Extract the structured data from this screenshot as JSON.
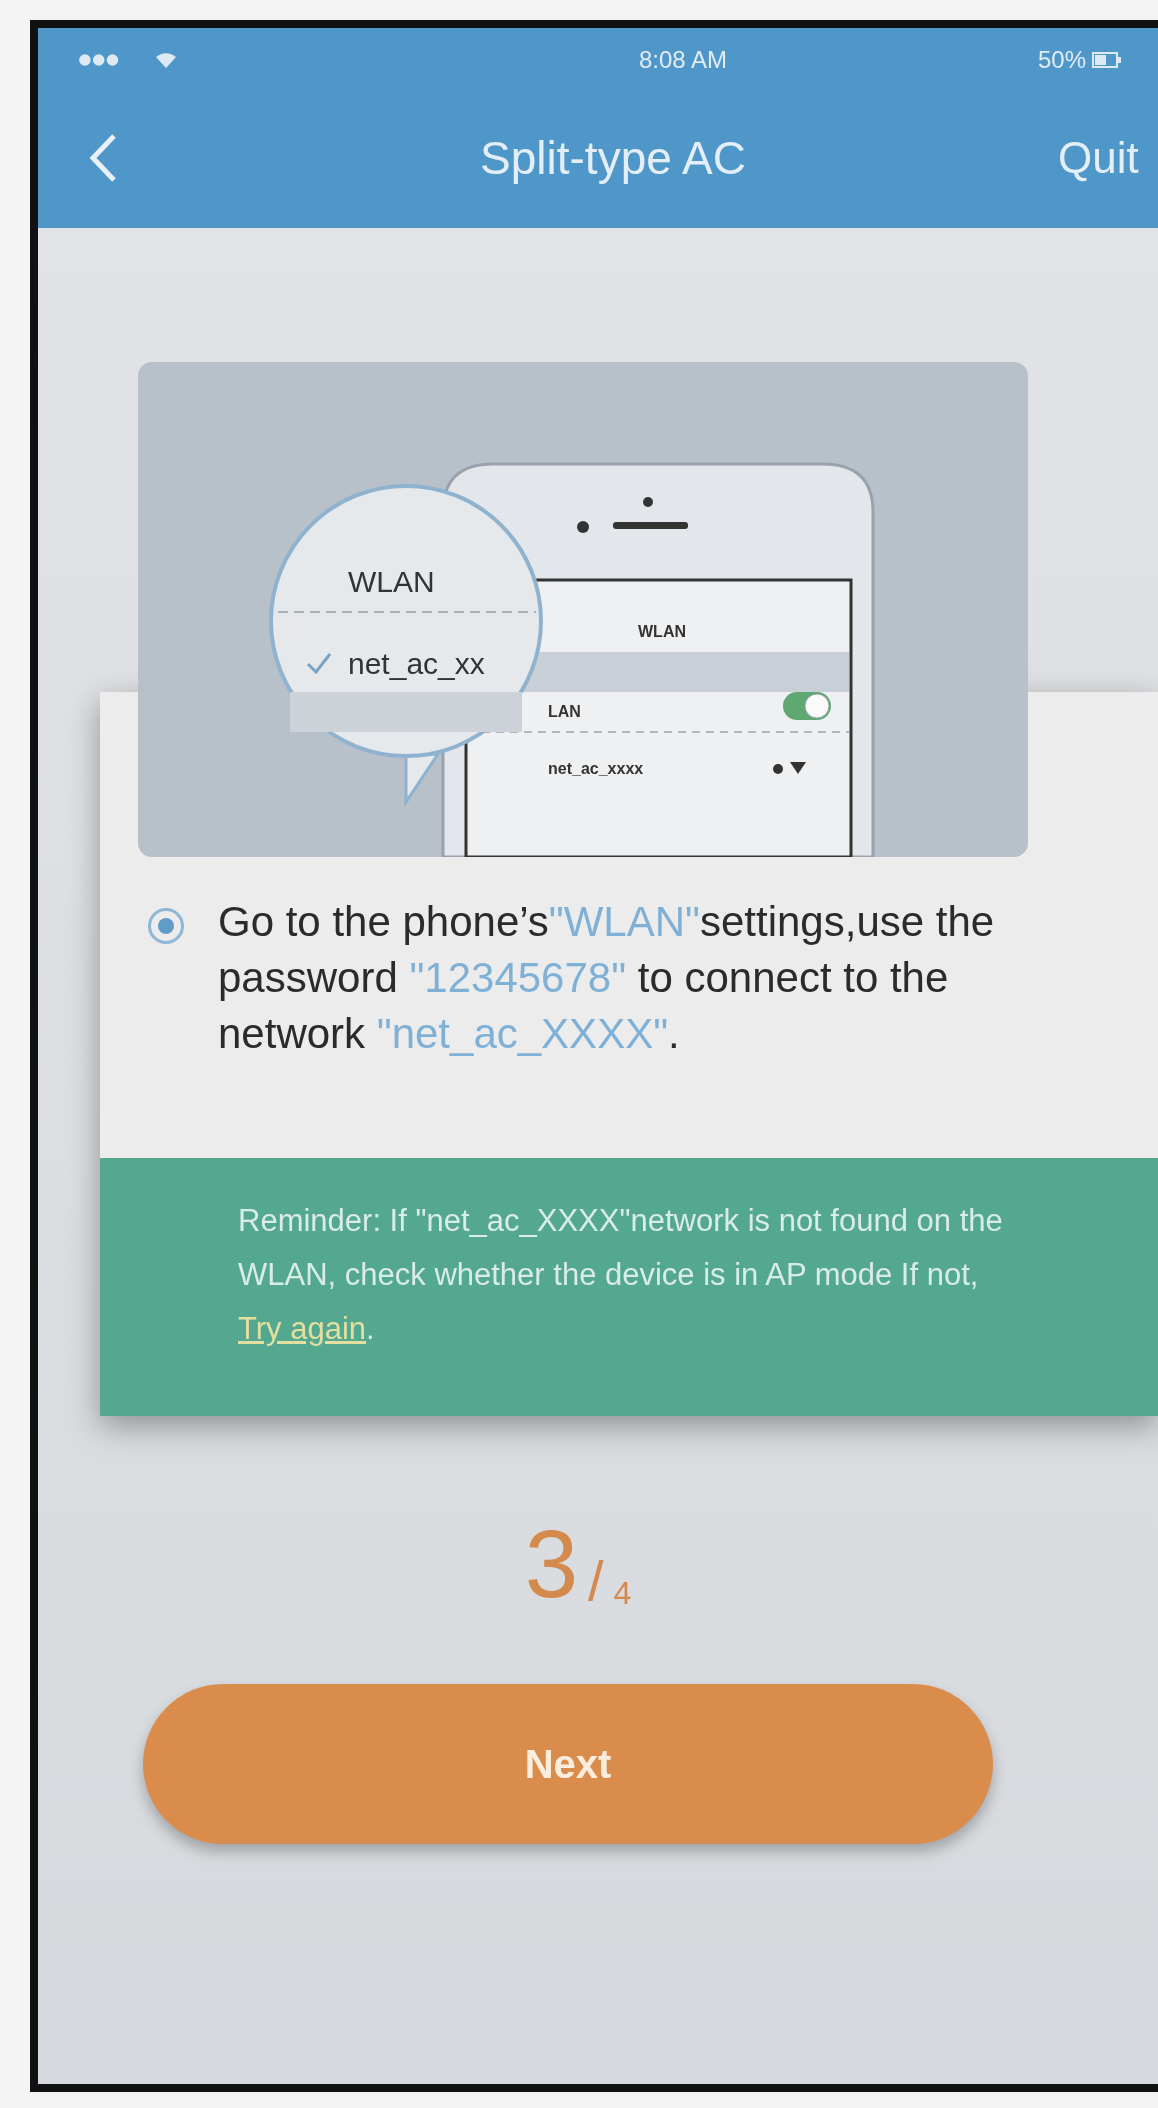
{
  "status_bar": {
    "time": "8:08 AM",
    "battery": "50%"
  },
  "nav": {
    "title": "Split-type AC",
    "action": "Quit"
  },
  "illustration": {
    "magnifier_title": "WLAN",
    "magnifier_network": "net_ac_xx",
    "magnifier_checked": true,
    "screen_title": "WLAN",
    "screen_row": "LAN",
    "screen_toggle_on": true,
    "screen_network": "net_ac_xxxx"
  },
  "instruction": {
    "selected": true,
    "parts": [
      {
        "text": "Go to the phone’s",
        "highlight": false
      },
      {
        "text": "\"WLAN\"",
        "highlight": true
      },
      {
        "text": "settings,use the password ",
        "highlight": false
      },
      {
        "text": "\"12345678\"",
        "highlight": true
      },
      {
        "text": " to connect to the network ",
        "highlight": false
      },
      {
        "text": "\"net_ac_XXXX\"",
        "highlight": true
      },
      {
        "text": ".",
        "highlight": false
      }
    ]
  },
  "reminder": {
    "text": "Reminder: If \"net_ac_XXXX\"network is not found on the WLAN, check whether the device is in AP mode If not, ",
    "link": "Try again",
    "end": "."
  },
  "step": {
    "current": "3",
    "separator": "/",
    "total": "4"
  },
  "next_button": "Next"
}
